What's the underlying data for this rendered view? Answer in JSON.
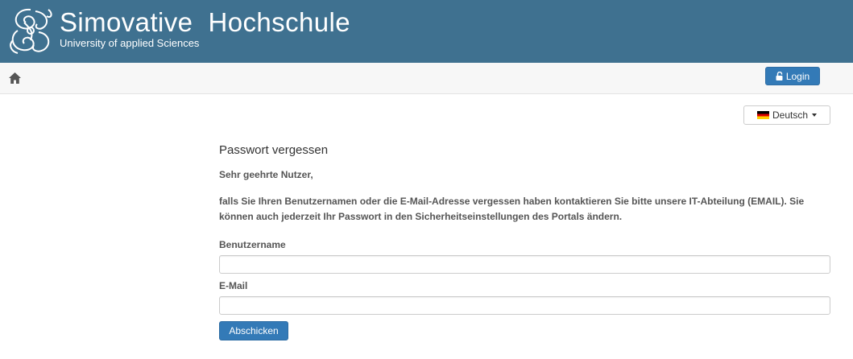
{
  "header": {
    "title": "Simovative  Hochschule",
    "subtitle": "University of applied Sciences"
  },
  "navbar": {
    "home_icon": "home-icon",
    "login_label": "Login",
    "login_icon": "unlock-icon"
  },
  "language": {
    "selected": "Deutsch",
    "flag": "flag-de-icon"
  },
  "form": {
    "title": "Passwort vergessen",
    "greeting": "Sehr geehrte Nutzer,",
    "body": "falls Sie Ihren Benutzernamen oder die E-Mail-Adresse vergessen haben kontaktieren Sie bitte unsere IT-Abteilung (EMAIL). Sie können auch jederzeit Ihr Passwort in den Sicherheitseinstellungen des Portals ändern.",
    "username_label": "Benutzername",
    "username_value": "",
    "email_label": "E-Mail",
    "email_value": "",
    "submit_label": "Abschicken"
  },
  "colors": {
    "header_bg": "#3f7190",
    "primary": "#337ab7"
  }
}
